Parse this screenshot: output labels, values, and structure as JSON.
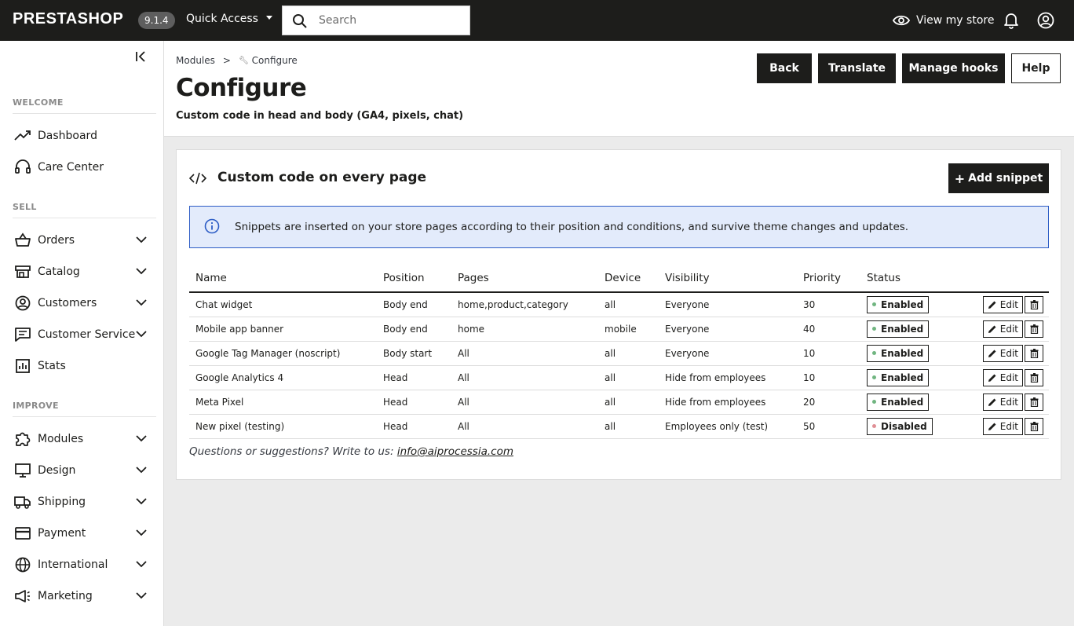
{
  "topbar": {
    "logo": "PRESTASHOP",
    "version": "9.1.4",
    "quick_access": "Quick Access",
    "search_placeholder": "Search",
    "view_store": "View my store"
  },
  "sidebar": {
    "sections": [
      {
        "title": "WELCOME"
      },
      {
        "title": "SELL"
      },
      {
        "title": "IMPROVE"
      }
    ],
    "items": [
      {
        "label": "Dashboard",
        "icon": "trending-up-icon"
      },
      {
        "label": "Care Center",
        "icon": "headset-icon"
      },
      {
        "label": "Orders",
        "icon": "basket-icon"
      },
      {
        "label": "Catalog",
        "icon": "store-icon"
      },
      {
        "label": "Customers",
        "icon": "account-circle-icon"
      },
      {
        "label": "Customer Service",
        "icon": "chat-icon"
      },
      {
        "label": "Stats",
        "icon": "bar-chart-icon"
      },
      {
        "label": "Modules",
        "icon": "puzzle-icon"
      },
      {
        "label": "Design",
        "icon": "desktop-icon"
      },
      {
        "label": "Shipping",
        "icon": "truck-icon"
      },
      {
        "label": "Payment",
        "icon": "credit-card-icon"
      },
      {
        "label": "International",
        "icon": "globe-icon"
      },
      {
        "label": "Marketing",
        "icon": "megaphone-icon"
      }
    ]
  },
  "header": {
    "breadcrumb": {
      "parent": "Modules",
      "separator": ">",
      "current": "Configure"
    },
    "title": "Configure",
    "subtitle": "Custom code in head and body (GA4, pixels, chat)",
    "buttons": {
      "back": "Back",
      "translate": "Translate",
      "manage_hooks": "Manage hooks",
      "help": "Help"
    }
  },
  "card": {
    "title": "Custom code on every page",
    "add_button": "Add snippet",
    "alert": "Snippets are inserted on your store pages according to their position and conditions, and survive theme changes and updates.",
    "columns": [
      "Name",
      "Position",
      "Pages",
      "Device",
      "Visibility",
      "Priority",
      "Status"
    ],
    "rows": [
      {
        "name": "Chat widget",
        "position": "Body end",
        "pages": "home,product,category",
        "device": "all",
        "visibility": "Everyone",
        "priority": "30",
        "status": "Enabled"
      },
      {
        "name": "Mobile app banner",
        "position": "Body end",
        "pages": "home",
        "device": "mobile",
        "visibility": "Everyone",
        "priority": "40",
        "status": "Enabled"
      },
      {
        "name": "Google Tag Manager (noscript)",
        "position": "Body start",
        "pages": "All",
        "device": "all",
        "visibility": "Everyone",
        "priority": "10",
        "status": "Enabled"
      },
      {
        "name": "Google Analytics 4",
        "position": "Head",
        "pages": "All",
        "device": "all",
        "visibility": "Hide from employees",
        "priority": "10",
        "status": "Enabled"
      },
      {
        "name": "Meta Pixel",
        "position": "Head",
        "pages": "All",
        "device": "all",
        "visibility": "Hide from employees",
        "priority": "20",
        "status": "Enabled"
      },
      {
        "name": "New pixel (testing)",
        "position": "Head",
        "pages": "All",
        "device": "all",
        "visibility": "Employees only (test)",
        "priority": "50",
        "status": "Disabled"
      }
    ],
    "edit_label": "Edit",
    "footer_text": "Questions or suggestions? Write to us: ",
    "footer_email": "info@aiprocessia.com"
  },
  "colors": {
    "dark": "#1d1d1b",
    "enabled_dot": "#70b580",
    "disabled_dot": "#e08f95",
    "alert_bg": "#e3ebfb",
    "alert_border": "#2c5cc5"
  }
}
